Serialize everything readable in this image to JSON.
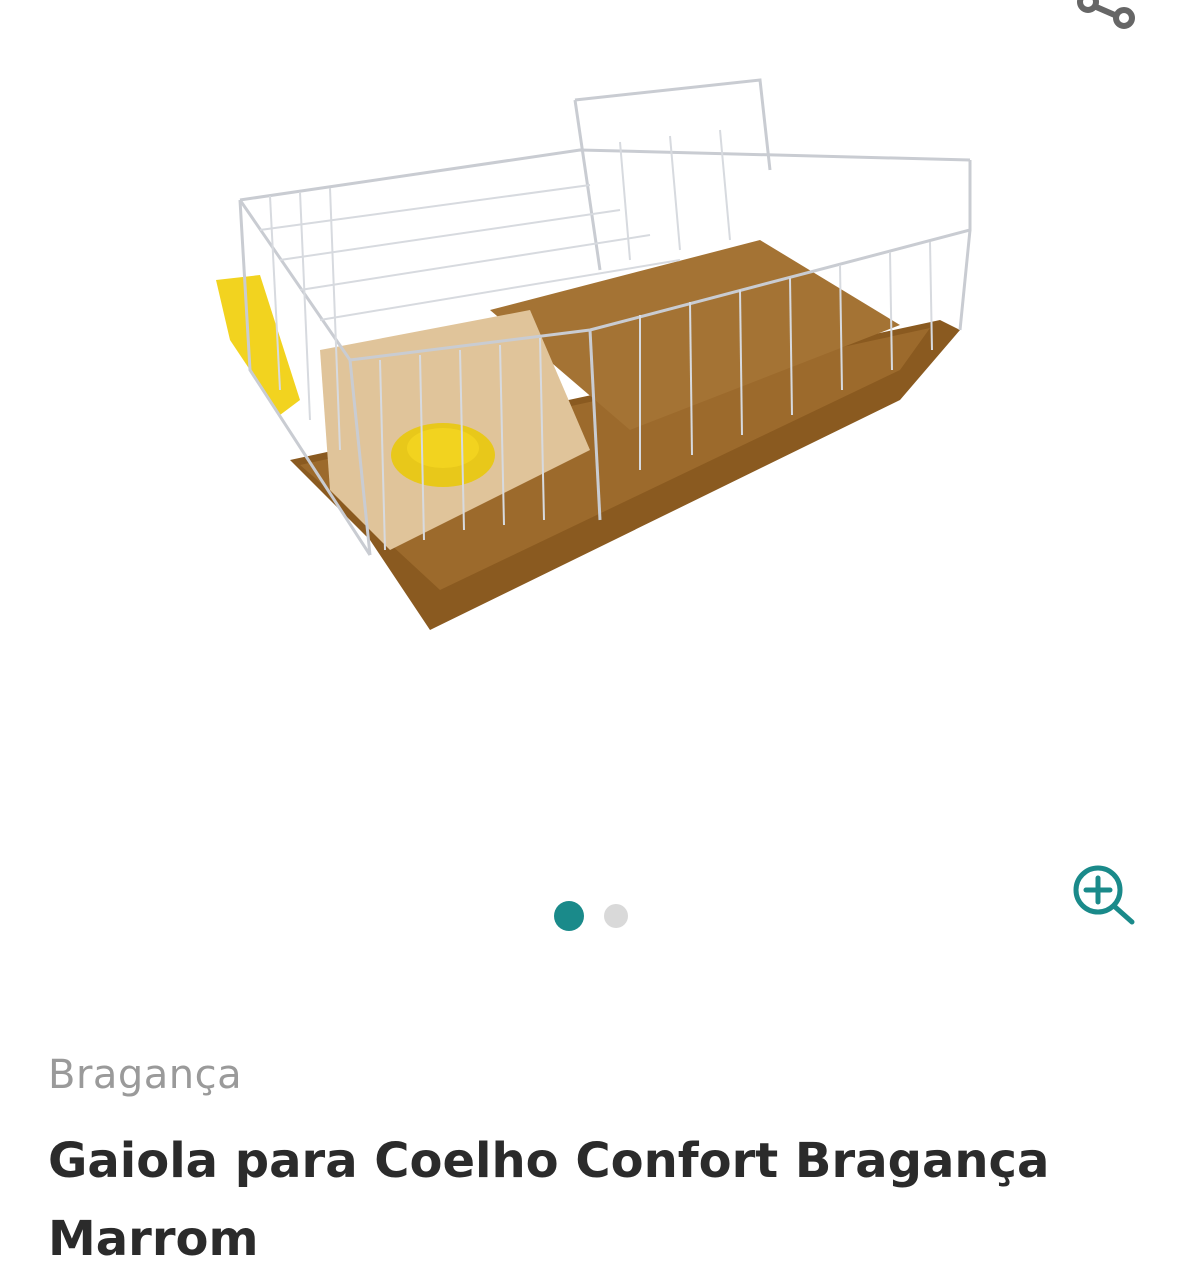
{
  "product": {
    "brand": "Bragança",
    "title": "Gaiola para Coelho Confort Bragança Marrom",
    "image_alt": "Gaiola para coelho marrom com grade metálica"
  },
  "gallery": {
    "total_images": 2,
    "active_index": 0
  },
  "colors": {
    "accent": "#1a8a8a",
    "dot_inactive": "#d9d9d9",
    "brand_text": "#9a9a9a",
    "title_text": "#2b2b2b",
    "cage_base": "#8a5a20",
    "feeder": "#f2d31f"
  },
  "icons": {
    "share": "share-icon",
    "zoom": "zoom-in-icon"
  }
}
